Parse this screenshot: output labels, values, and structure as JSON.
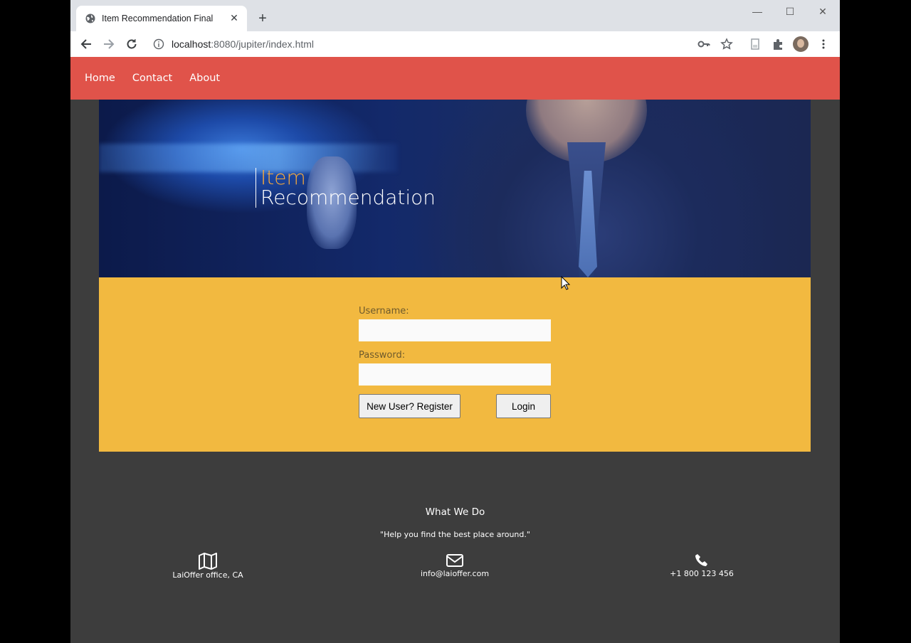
{
  "browser": {
    "tab_title": "Item Recommendation Final",
    "url_host": "localhost",
    "url_path": ":8080/jupiter/index.html"
  },
  "nav": {
    "items": [
      {
        "label": "Home"
      },
      {
        "label": "Contact"
      },
      {
        "label": "About"
      }
    ]
  },
  "hero": {
    "title_line1": "Item",
    "title_line2": "Recommendation"
  },
  "login": {
    "username_label": "Username:",
    "username_value": "",
    "password_label": "Password:",
    "password_value": "",
    "register_button": "New User? Register",
    "login_button": "Login"
  },
  "footer": {
    "heading": "What We Do",
    "quote": "\"Help you find the best place around.\"",
    "location": "LaiOffer office, CA",
    "email": "info@laioffer.com",
    "phone": "+1 800 123 456"
  },
  "colors": {
    "nav_bg": "#e0534a",
    "login_bg": "#f2b940",
    "page_bg": "#3d3d3d",
    "hero_accent": "#f7a93b"
  }
}
